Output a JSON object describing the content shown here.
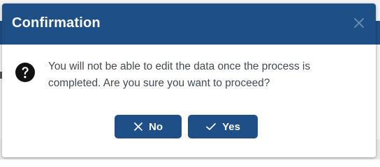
{
  "dialog": {
    "title": "Confirmation",
    "message": "You will not be able to edit the data once the process is completed. Are you sure you want to proceed?",
    "icons": {
      "close": "close-icon",
      "question": "question-circle-icon",
      "no": "x-icon",
      "yes": "check-icon"
    },
    "buttons": {
      "no_label": "No",
      "yes_label": "Yes"
    }
  },
  "colors": {
    "header_bg": "#1e4f86",
    "button_bg": "#1e4f86",
    "title_text": "#ffffff",
    "body_text": "#444a52"
  }
}
